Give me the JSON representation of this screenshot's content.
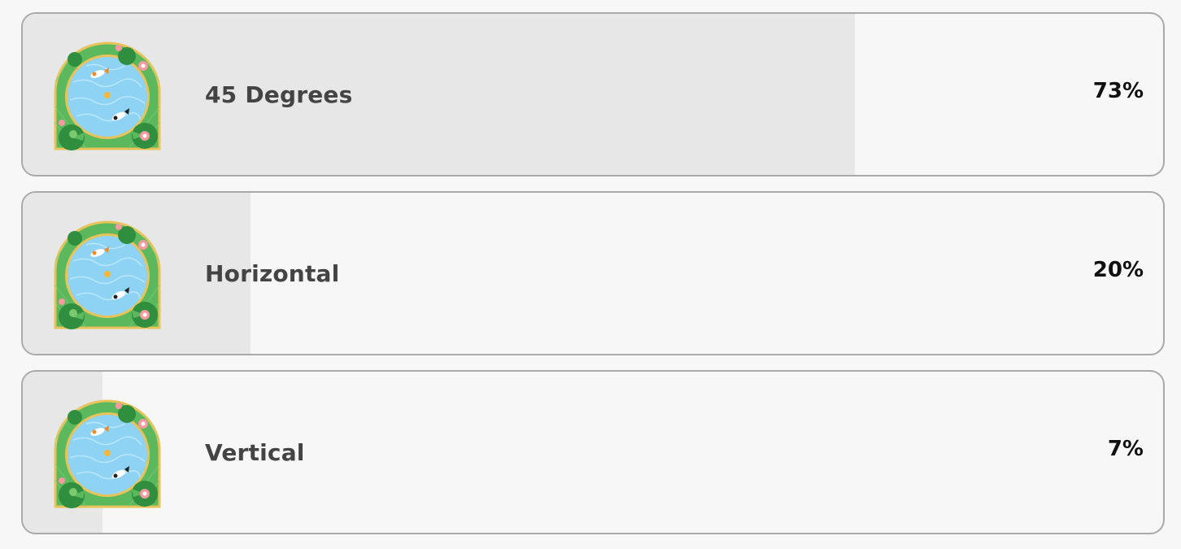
{
  "poll": {
    "options": [
      {
        "label": "45 Degrees",
        "percent_text": "73%",
        "percent": 73,
        "image": "koi-pond-icon"
      },
      {
        "label": "Horizontal",
        "percent_text": "20%",
        "percent": 20,
        "image": "koi-pond-icon"
      },
      {
        "label": "Vertical",
        "percent_text": "7%",
        "percent": 7,
        "image": "koi-pond-icon"
      }
    ]
  },
  "colors": {
    "border": "#a9a9a9",
    "fill": "#e7e7e7",
    "background": "#f7f7f7",
    "label": "#444444",
    "percent": "#111111"
  }
}
